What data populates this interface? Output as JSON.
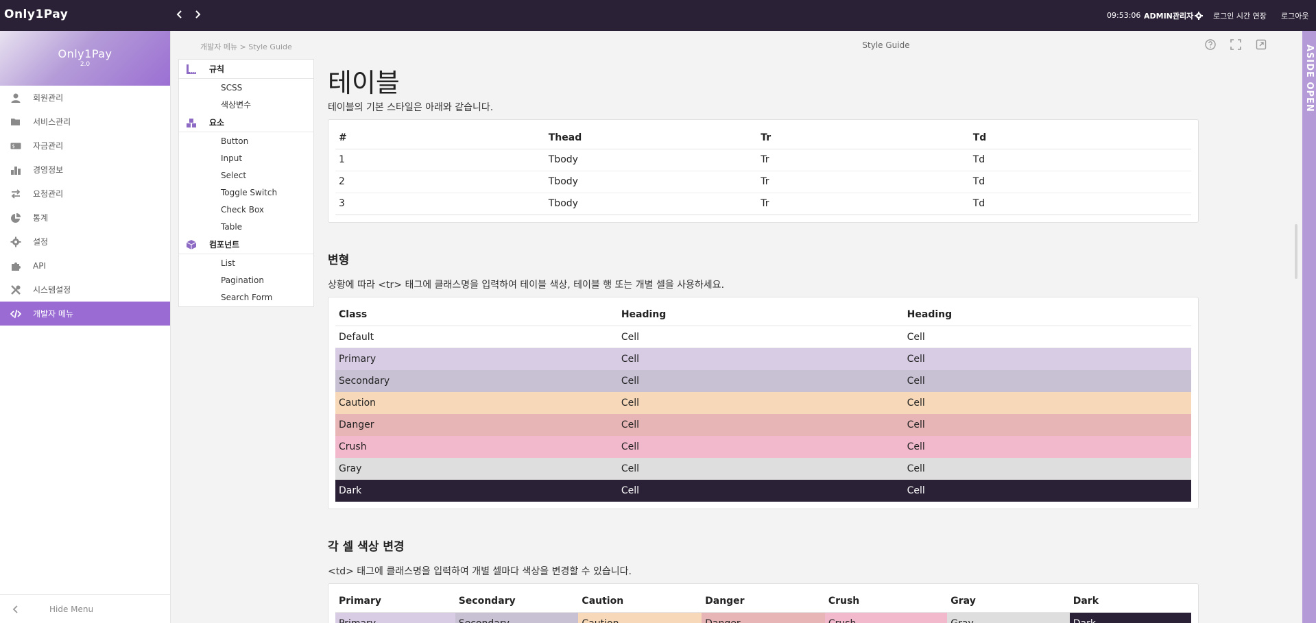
{
  "topbar": {
    "brand": "Only1Pay",
    "time": "09:53:06",
    "admin": "ADMIN관리자",
    "extend_login": "로그인 시간 연장",
    "logout": "로그아웃"
  },
  "sidebar": {
    "logo": "Only1Pay",
    "version": "2.0",
    "items": [
      {
        "label": "회원관리",
        "icon": "user-icon"
      },
      {
        "label": "서비스관리",
        "icon": "folder-icon"
      },
      {
        "label": "자금관리",
        "icon": "money-icon"
      },
      {
        "label": "경영정보",
        "icon": "chart-icon"
      },
      {
        "label": "요청관리",
        "icon": "exchange-icon"
      },
      {
        "label": "통계",
        "icon": "pie-chart-icon"
      },
      {
        "label": "설정",
        "icon": "gear-icon"
      },
      {
        "label": "API",
        "icon": "puzzle-icon"
      },
      {
        "label": "시스템설정",
        "icon": "tools-icon"
      },
      {
        "label": "개발자 메뉴",
        "icon": "code-icon",
        "active": true
      }
    ],
    "hide_menu": "Hide Menu"
  },
  "breadcrumb": "개발자 메뉴 > Style Guide",
  "page_title": "Style Guide",
  "aside_toggle": "ASIDE OPEN",
  "toc": {
    "sections": [
      {
        "title": "규칙",
        "icon": "ruler-icon",
        "items": [
          "SCSS",
          "색상변수"
        ]
      },
      {
        "title": "요소",
        "icon": "blocks-icon",
        "items": [
          "Button",
          "Input",
          "Select",
          "Toggle Switch",
          "Check Box",
          "Table"
        ]
      },
      {
        "title": "컴포넌트",
        "icon": "cube-icon",
        "items": [
          "List",
          "Pagination",
          "Search Form"
        ]
      }
    ]
  },
  "content": {
    "heading": "테이블",
    "intro": "테이블의 기본 스타일은 아래와 같습니다.",
    "basic_table": {
      "headers": [
        "#",
        "Thead",
        "Tr",
        "Td"
      ],
      "rows": [
        [
          "1",
          "Tbody",
          "Tr",
          "Td"
        ],
        [
          "2",
          "Tbody",
          "Tr",
          "Td"
        ],
        [
          "3",
          "Tbody",
          "Tr",
          "Td"
        ]
      ]
    },
    "variant_heading": "변형",
    "variant_desc": "상황에 따라 <tr> 태그에 클래스명을 입력하여 테이블 색상, 테이블 행 또는 개별 셀을 사용하세요.",
    "variant_table": {
      "headers": [
        "Class",
        "Heading",
        "Heading"
      ],
      "rows": [
        [
          "Default",
          "Cell",
          "Cell"
        ],
        [
          "Primary",
          "Cell",
          "Cell"
        ],
        [
          "Secondary",
          "Cell",
          "Cell"
        ],
        [
          "Caution",
          "Cell",
          "Cell"
        ],
        [
          "Danger",
          "Cell",
          "Cell"
        ],
        [
          "Crush",
          "Cell",
          "Cell"
        ],
        [
          "Gray",
          "Cell",
          "Cell"
        ],
        [
          "Dark",
          "Cell",
          "Cell"
        ]
      ]
    },
    "cell_heading": "각 셀 색상 변경",
    "cell_desc": "<td> 태그에 클래스명을 입력하여 개별 셀마다 색상을 변경할 수 있습니다.",
    "cell_table": {
      "headers": [
        "Primary",
        "Secondary",
        "Caution",
        "Danger",
        "Crush",
        "Gray",
        "Dark"
      ],
      "row": [
        "Primary",
        "Secondary",
        "Caution",
        "Danger",
        "Crush",
        "Gray",
        "Dark"
      ]
    }
  },
  "colors": {
    "topbar": "#2a2136",
    "accent": "#9a6cd3",
    "primary": "#d8cce5",
    "secondary": "#c8c1d4",
    "caution": "#f7d9b9",
    "danger": "#e8b5b7",
    "crush": "#f2b8cc",
    "gray": "#dedede",
    "dark": "#2a2136"
  }
}
